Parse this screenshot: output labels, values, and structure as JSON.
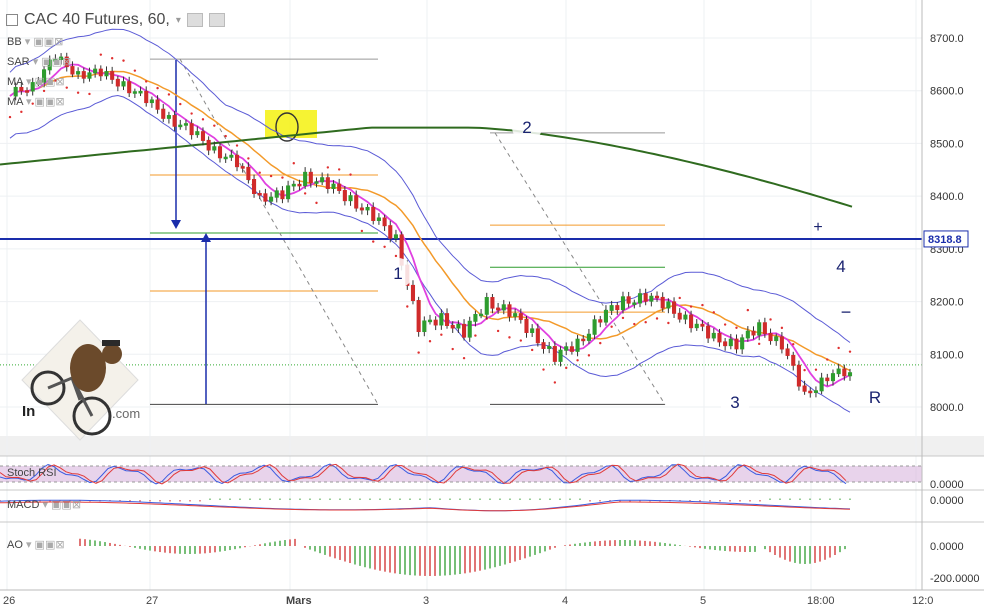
{
  "header": {
    "title": "CAC 40 Futures, 60,",
    "chevron": "chevron-down-icon",
    "eye_icon": "eye-icon",
    "settings_icon": "gear-icon"
  },
  "indicator_labels": [
    {
      "name": "BB"
    },
    {
      "name": "SAR"
    },
    {
      "name": "MA"
    },
    {
      "name": "MA"
    }
  ],
  "panels": {
    "stoch_label": "Stoch RSI",
    "macd_label": "MACD",
    "ao_label": "AO"
  },
  "price_axis": {
    "ticks": [
      "8700.0",
      "8600.0",
      "8500.0",
      "8400.0",
      "8300.0",
      "8200.0",
      "8100.0",
      "8000.0"
    ],
    "current_label": "8318.8",
    "current_color": "#1919a8"
  },
  "sub_axes": {
    "stoch": [
      "0.0000"
    ],
    "macd": [
      "0.0000"
    ],
    "ao": [
      "0.0000",
      "-200.0000"
    ]
  },
  "time_axis": [
    "26",
    "27",
    "Mars",
    "3",
    "4",
    "5",
    "18:00",
    "12:0"
  ],
  "markers": {
    "n1": "1",
    "n2": "2",
    "n3": "3",
    "n4": "4",
    "plus": "+",
    "minus": "−",
    "r": "R"
  },
  "logo": {
    "text_fragment": ".com",
    "prefix": "In"
  },
  "colors": {
    "bull": "#2e9c2e",
    "bear": "#d02b2b",
    "bb": "#5b5bd6",
    "ma_fast": "#e040e0",
    "ma_mid": "#f39a2a",
    "ma_slow": "#2f6b1f",
    "sar": "#e03030",
    "hline": "#1a2dab",
    "stoch_band": "#d9b5dd"
  },
  "chart_data": {
    "type": "candlestick",
    "title": "CAC 40 Futures, 60,",
    "y_range": [
      7950,
      8760
    ],
    "series": [
      {
        "name": "BB",
        "kind": "band"
      },
      {
        "name": "SAR",
        "kind": "dots"
      },
      {
        "name": "MA",
        "kind": "line"
      },
      {
        "name": "MA",
        "kind": "line"
      }
    ],
    "close_path": [
      8590,
      8615,
      8660,
      8635,
      8630,
      8615,
      8580,
      8550,
      8520,
      8490,
      8460,
      8400,
      8400,
      8440,
      8420,
      8395,
      8360,
      8320,
      8150,
      8170,
      8140,
      8200,
      8180,
      8140,
      8095,
      8120,
      8170,
      8200,
      8210,
      8190,
      8160,
      8130,
      8120,
      8150,
      8120,
      8020,
      8060,
      8065
    ],
    "reference_levels": [
      8318.8,
      8660,
      8520,
      8440,
      8330,
      8220
    ],
    "stoch_rsi_range": [
      0,
      100
    ],
    "macd_zero": 0,
    "ao_range": [
      -220,
      40
    ]
  }
}
